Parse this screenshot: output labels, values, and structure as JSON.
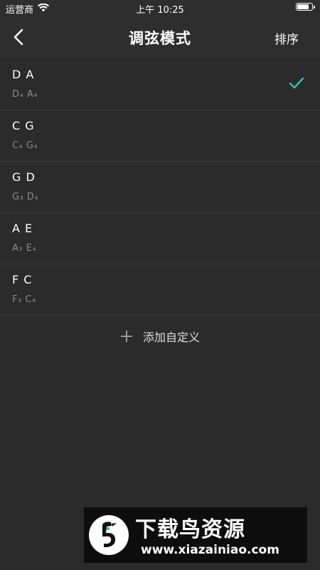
{
  "status_bar": {
    "carrier": "运营商",
    "time": "上午 10:25",
    "battery_level": 0.85
  },
  "nav": {
    "title": "调弦模式",
    "sort_label": "排序"
  },
  "tunings": [
    {
      "name": "D  A",
      "notes": "D₄   A₄",
      "selected": true
    },
    {
      "name": "C  G",
      "notes": "C₄   G₄",
      "selected": false
    },
    {
      "name": "G  D",
      "notes": "G₃   D₄",
      "selected": false
    },
    {
      "name": "A  E",
      "notes": "A₃   E₄",
      "selected": false
    },
    {
      "name": "F  C",
      "notes": "F₃   C₄",
      "selected": false
    }
  ],
  "add_custom": {
    "label": "添加自定义"
  },
  "watermark": {
    "title": "下载鸟资源",
    "url": "www.xiazainiao.com"
  },
  "colors": {
    "accent": "#2fc5b8",
    "background": "#2b2b2b"
  }
}
